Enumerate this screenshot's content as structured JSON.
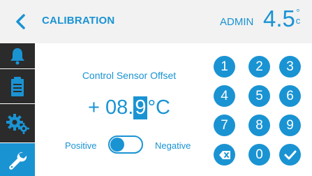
{
  "header": {
    "title": "CALIBRATION",
    "user": "ADMIN",
    "temperature": "4.5",
    "temperature_unit_top": "°",
    "temperature_unit_bottom": "c"
  },
  "sidebar": {
    "items": [
      {
        "icon": "bell-icon",
        "active": false
      },
      {
        "icon": "clipboard-icon",
        "active": false
      },
      {
        "icon": "gears-icon",
        "active": false
      },
      {
        "icon": "wrench-icon",
        "active": true
      }
    ]
  },
  "main": {
    "field_label": "Control Sensor Offset",
    "value_prefix": "+ 08.",
    "value_cursor_digit": "9",
    "value_unit": " °C",
    "toggle": {
      "left_label": "Positive",
      "right_label": "Negative",
      "state": "Positive"
    }
  },
  "keypad": {
    "keys": [
      "1",
      "2",
      "3",
      "4",
      "5",
      "6",
      "7",
      "8",
      "9"
    ],
    "zero": "0",
    "backspace_icon": "backspace-icon",
    "confirm_icon": "check-icon"
  },
  "colors": {
    "accent": "#1a93d3",
    "sidebar_bg": "#2b2b2b",
    "header_bg": "#f2f2f2"
  }
}
